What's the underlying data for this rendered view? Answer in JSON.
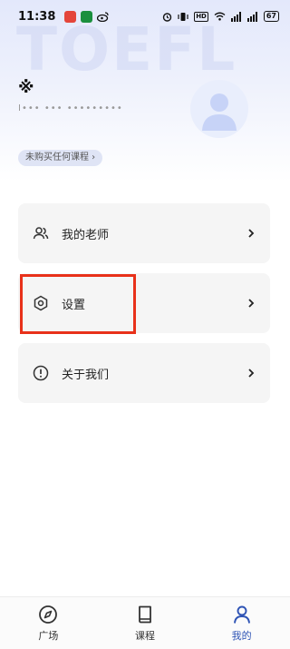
{
  "status_bar": {
    "time": "11:38",
    "battery": "67"
  },
  "header": {
    "watermark": "TOEFL",
    "username": "※",
    "user_meta": "I••• ••• •••••••••"
  },
  "course_tag": {
    "label": "未购买任何课程 ›"
  },
  "menu": [
    {
      "label": "我的老师",
      "icon": "users-icon"
    },
    {
      "label": "设置",
      "icon": "settings-hexagon-icon"
    },
    {
      "label": "关于我们",
      "icon": "info-circle-icon"
    }
  ],
  "bottom_nav": [
    {
      "label": "广场",
      "icon": "compass-icon",
      "active": false
    },
    {
      "label": "课程",
      "icon": "book-icon",
      "active": false
    },
    {
      "label": "我的",
      "icon": "person-icon",
      "active": true
    }
  ],
  "colors": {
    "accent": "#2f54b5",
    "highlight": "#e8311a"
  }
}
